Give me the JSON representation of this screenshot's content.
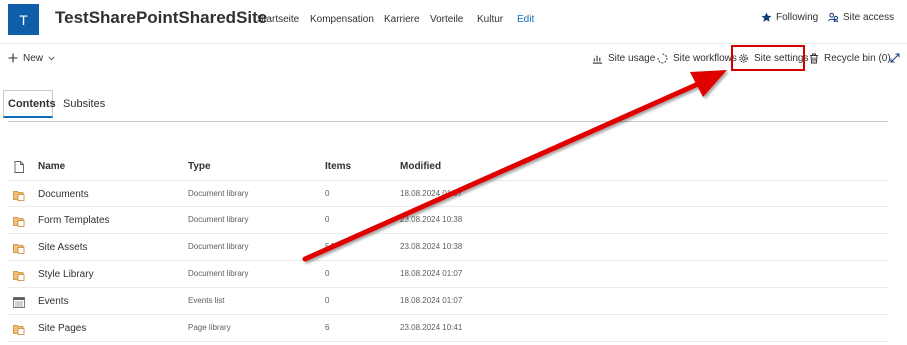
{
  "site": {
    "logo_letter": "T",
    "title": "TestSharePointSharedSite"
  },
  "topnav": [
    "Startseite",
    "Kompensation",
    "Karriere",
    "Vorteile",
    "Kultur",
    "Edit"
  ],
  "header_actions": {
    "following": "Following",
    "site_access": "Site access"
  },
  "commandbar": {
    "new": "New",
    "site_usage": "Site usage",
    "site_workflows": "Site workflows",
    "site_settings": "Site settings",
    "recycle_bin": "Recycle bin (0)"
  },
  "tabs": [
    "Contents",
    "Subsites"
  ],
  "table": {
    "columns": {
      "name": "Name",
      "type": "Type",
      "items": "Items",
      "modified": "Modified"
    },
    "rows": [
      {
        "icon": "library-icon",
        "name": "Documents",
        "type": "Document library",
        "items": "0",
        "modified": "18.08.2024 01:07"
      },
      {
        "icon": "library-icon",
        "name": "Form Templates",
        "type": "Document library",
        "items": "0",
        "modified": "23.08.2024 10:38"
      },
      {
        "icon": "library-icon",
        "name": "Site Assets",
        "type": "Document library",
        "items": "54",
        "modified": "23.08.2024 10:38"
      },
      {
        "icon": "library-icon",
        "name": "Style Library",
        "type": "Document library",
        "items": "0",
        "modified": "18.08.2024 01:07"
      },
      {
        "icon": "events-list-icon",
        "name": "Events",
        "type": "Events list",
        "items": "0",
        "modified": "18.08.2024 01:07"
      },
      {
        "icon": "library-icon",
        "name": "Site Pages",
        "type": "Page library",
        "items": "6",
        "modified": "23.08.2024 10:41"
      }
    ]
  },
  "colors": {
    "brand": "#0f5fa8",
    "accent": "#0f6cbd",
    "annotation": "#e00000"
  }
}
